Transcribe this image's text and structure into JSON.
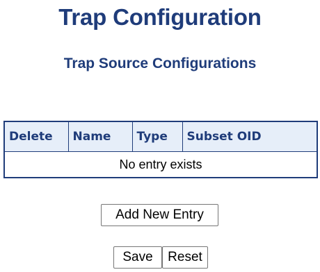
{
  "page": {
    "title": "Trap Configuration",
    "section_title": "Trap Source Configurations"
  },
  "table": {
    "columns": [
      "Delete",
      "Name",
      "Type",
      "Subset OID"
    ],
    "empty_message": "No entry exists"
  },
  "buttons": {
    "add_new_entry": "Add New Entry",
    "save": "Save",
    "reset": "Reset"
  },
  "colors": {
    "title": "#1f3c7a",
    "table_header_bg": "#e6eef9",
    "table_border": "#1f3c7a"
  }
}
